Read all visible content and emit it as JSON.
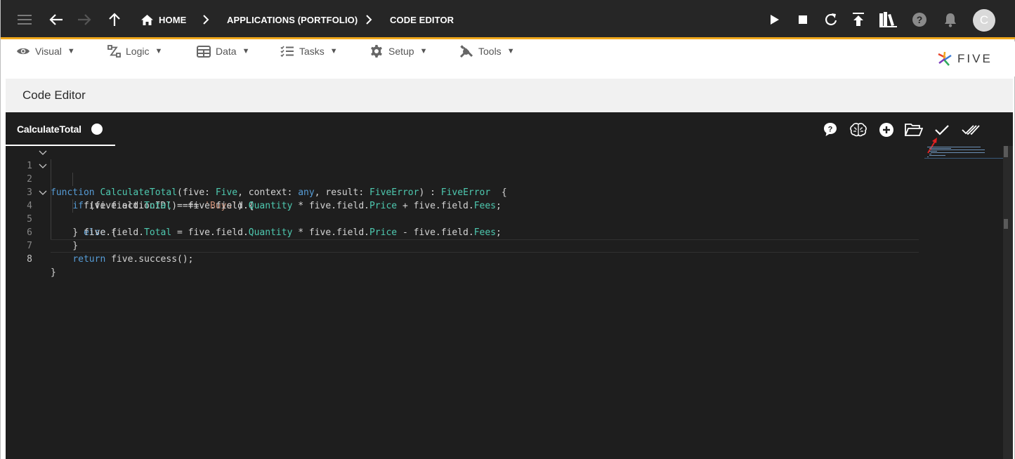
{
  "appbar": {
    "breadcrumbs": [
      "HOME",
      "APPLICATIONS (PORTFOLIO)",
      "CODE EDITOR"
    ],
    "user_initial": "C",
    "accent_color": "#f0a81c"
  },
  "menu": {
    "items": [
      {
        "label": "Visual",
        "icon": "eye-icon"
      },
      {
        "label": "Logic",
        "icon": "flow-icon"
      },
      {
        "label": "Data",
        "icon": "table-icon"
      },
      {
        "label": "Tasks",
        "icon": "checklist-icon"
      },
      {
        "label": "Setup",
        "icon": "gear-icon"
      },
      {
        "label": "Tools",
        "icon": "tools-icon"
      }
    ],
    "logo_text": "FIVE"
  },
  "page": {
    "title": "Code Editor"
  },
  "editor": {
    "tab_label": "CalculateTotal",
    "line_numbers": [
      "1",
      "2",
      "3",
      "4",
      "5",
      "6",
      "7",
      "8"
    ],
    "active_line": "8",
    "lines": [
      "function CalculateTotal(five: Five, context: any, result: FiveError) : FiveError  {",
      "    if (five.actionID() === 'Buys') {",
      "      five.field.Total = five.field.Quantity * five.field.Price + five.field.Fees;",
      "    } else {",
      "      five.field.Total = five.field.Quantity * five.field.Price - five.field.Fees;",
      "    }",
      "    return five.success();",
      "}"
    ],
    "toolbar": [
      "help-icon",
      "brain-icon",
      "add-icon",
      "folder-open-icon",
      "check-icon",
      "double-check-icon"
    ]
  }
}
